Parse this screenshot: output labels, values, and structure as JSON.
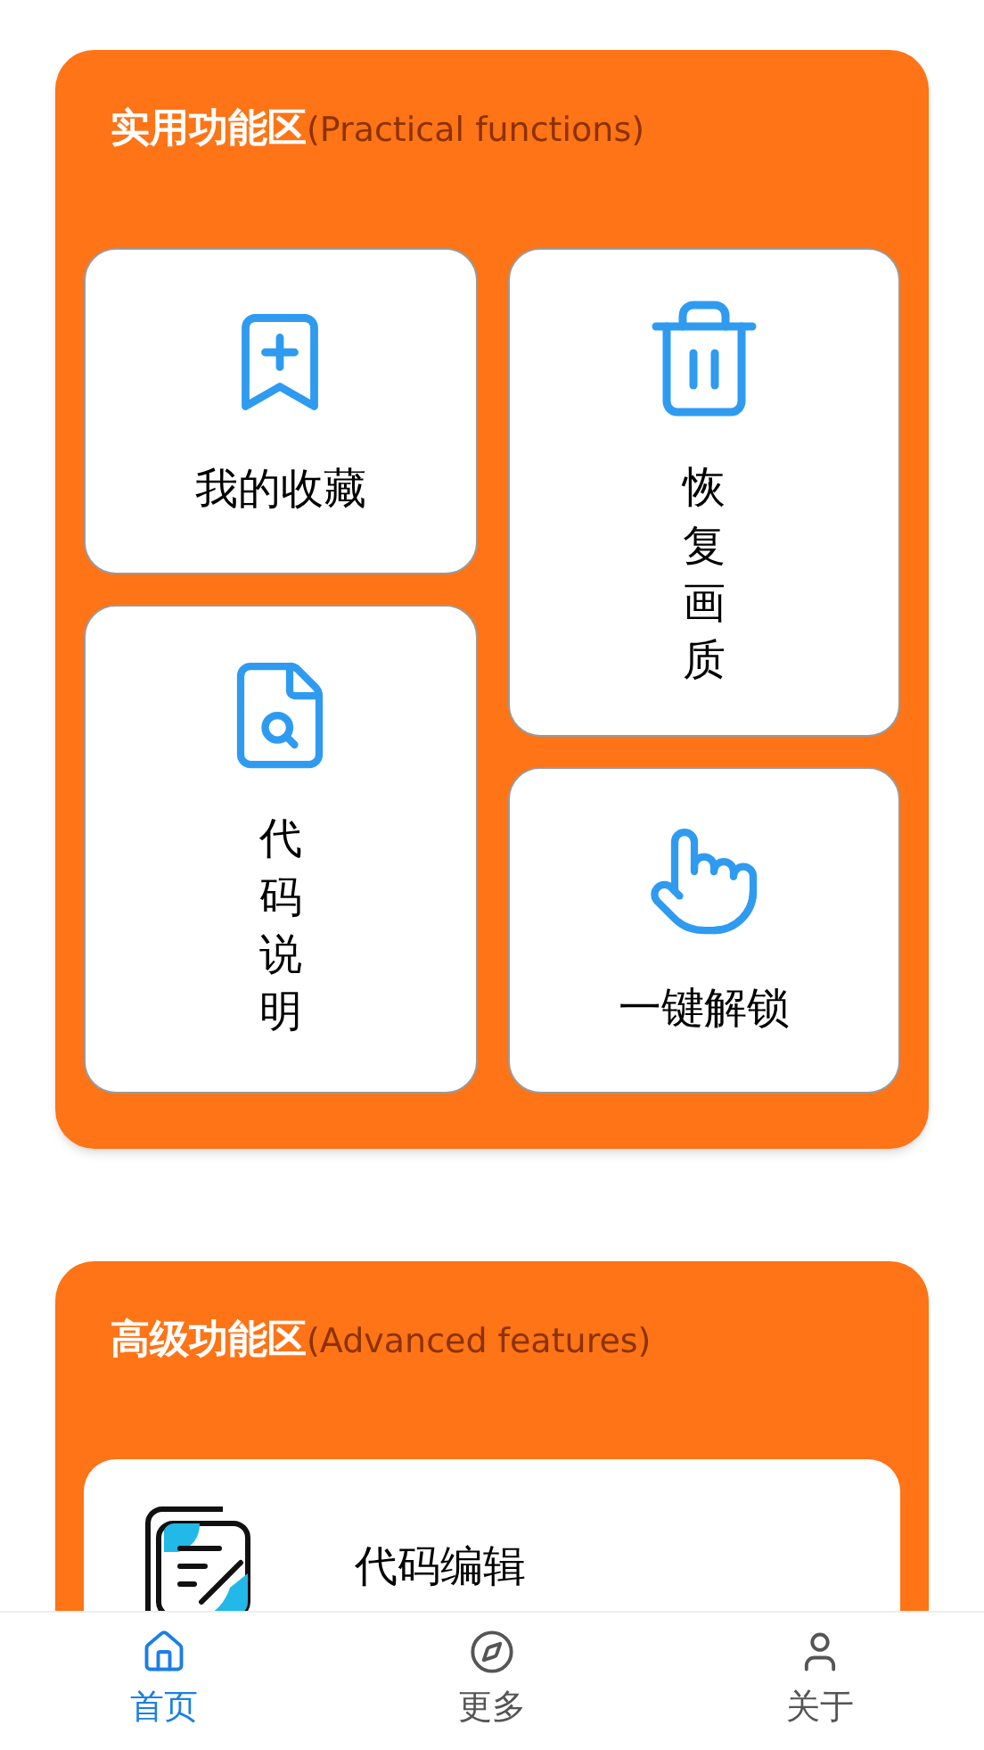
{
  "sections": [
    {
      "kind": "grid",
      "title": "实用功能区",
      "subtitle": "(Practical functions)",
      "columns": [
        [
          {
            "label": "我的收藏",
            "kind": "bookmark",
            "vertical": false
          },
          {
            "label": "代码说明",
            "kind": "doc-search",
            "vertical": true
          }
        ],
        [
          {
            "label": "恢复画质",
            "kind": "trash",
            "vertical": true
          },
          {
            "label": "一键解锁",
            "kind": "tap",
            "vertical": false
          }
        ]
      ]
    },
    {
      "kind": "list",
      "title": "高级功能区",
      "subtitle": "(Advanced features)",
      "rows": [
        {
          "label": "代码编辑",
          "kind": "editor"
        }
      ]
    }
  ],
  "nav": [
    {
      "label": "首页",
      "kind": "home",
      "selected": true
    },
    {
      "label": "更多",
      "kind": "compass",
      "selected": false
    },
    {
      "label": "关于",
      "kind": "user",
      "selected": false
    }
  ]
}
